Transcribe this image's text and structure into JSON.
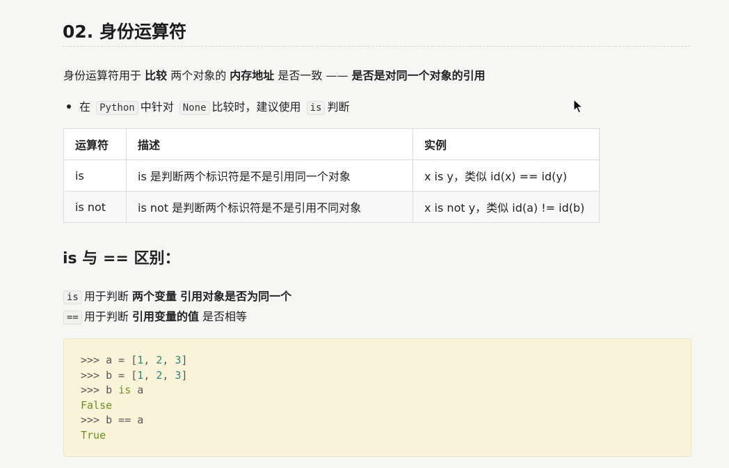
{
  "heading": "02. 身份运算符",
  "intro": {
    "part1": "身份运算符用于 ",
    "bold1": "比较",
    "part2": " 两个对象的 ",
    "bold2": "内存地址",
    "part3": " 是否一致 —— ",
    "bold3": "是否是对同一个对象的引用"
  },
  "bullet": {
    "p1": "在",
    "code1": "Python",
    "p2": "中针对",
    "code2": "None",
    "p3": "比较时，建议使用",
    "code3": "is",
    "p4": "判断"
  },
  "table": {
    "headers": [
      "运算符",
      "描述",
      "实例"
    ],
    "rows": [
      [
        "is",
        "is 是判断两个标识符是不是引用同一个对象",
        "x is y，类似 id(x) == id(y)"
      ],
      [
        "is not",
        "is not 是判断两个标识符是不是引用不同对象",
        "x is not y，类似 id(a) != id(b)"
      ]
    ]
  },
  "subheading": "is 与 == 区别：",
  "diff": {
    "line1": {
      "code": "is",
      "p1": "用于判断 ",
      "b1": "两个变量",
      "p2": " ",
      "b2": "引用对象是否为同一个"
    },
    "line2": {
      "code": "==",
      "p1": "用于判断 ",
      "b1": "引用变量的值",
      "p2": " 是否相等"
    }
  },
  "code": {
    "l1_prompt": ">>> a = [",
    "l1_n1": "1",
    "l1_s1": ", ",
    "l1_n2": "2",
    "l1_s2": ", ",
    "l1_n3": "3",
    "l1_end": "]",
    "l2_prompt": ">>> b = [",
    "l2_n1": "1",
    "l2_s1": ", ",
    "l2_n2": "2",
    "l2_s2": ", ",
    "l2_n3": "3",
    "l2_end": "]",
    "l3_a": ">>> b ",
    "l3_kw": "is",
    "l3_b": " a",
    "l4": "False",
    "l5": ">>> b == a",
    "l6": "True"
  },
  "icons": {
    "cursor": "mouse-pointer-icon"
  }
}
